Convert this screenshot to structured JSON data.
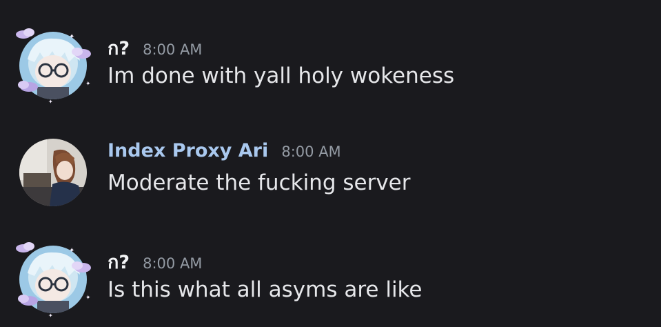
{
  "messages": [
    {
      "author": "ก?",
      "time": "8:00 AM",
      "text": "Im done with yall holy wokeness",
      "avatar": "anime-avatar-glasses-icon",
      "decoration": "cloud-sparkle-icon"
    },
    {
      "author": "Index Proxy Ari",
      "time": "8:00 AM",
      "text": "Moderate the fucking server",
      "author_color": "#a9c8ee",
      "avatar": "anime-avatar-brown-hair-icon"
    },
    {
      "author": "ก?",
      "time": "8:00 AM",
      "text": "Is this what all asyms are like",
      "avatar": "anime-avatar-glasses-icon",
      "decoration": "cloud-sparkle-icon"
    }
  ],
  "colors": {
    "background": "#1a1a1e",
    "text": "#e6e7ea",
    "timestamp": "#949ba4",
    "role_blue": "#a9c8ee"
  }
}
